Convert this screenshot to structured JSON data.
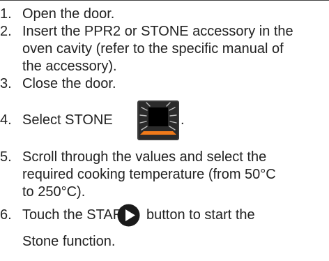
{
  "steps": [
    {
      "num": "1.",
      "text": "Open the door."
    },
    {
      "num": "2.",
      "lines": [
        "Insert the PPR2 or STONE accessory in the",
        "oven cavity (refer to the specific manual of",
        "the accessory)."
      ]
    },
    {
      "num": "3.",
      "text": "Close the door."
    },
    {
      "num": "4.",
      "before": "Select STONE",
      "after": "."
    },
    {
      "num": "5.",
      "lines": [
        "Scroll through the values and select the",
        "required cooking temperature (from 50°C",
        "to 250°C)."
      ]
    },
    {
      "num": "6.",
      "before": "Touch the START",
      "after": "button to start the",
      "line2": "Stone function."
    }
  ],
  "icons": {
    "stone": "stone-function-icon",
    "start": "start-play-icon"
  },
  "colors": {
    "text": "#222222",
    "stone_bg": "#333333",
    "stone_accent": "#f07a1a",
    "start_bg": "#1a1a1a"
  }
}
